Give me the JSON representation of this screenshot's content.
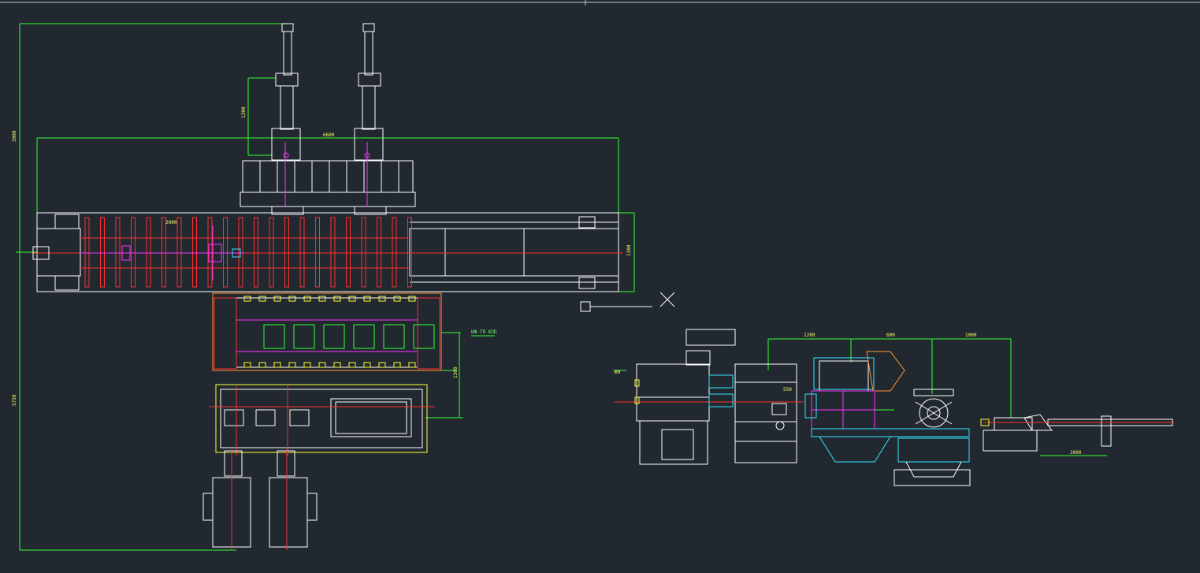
{
  "viewport": {
    "background": "#212830"
  },
  "colors": {
    "geometry": "#ffffff",
    "centerline": "#ff3030",
    "dimension": "#33ff33",
    "magenta": "#ff33ff",
    "cyan": "#33e6ff",
    "orange": "#ff9933",
    "yellow": "#ffff33",
    "dim_text": "#ffff66"
  },
  "icons": {
    "crosshair": "crosshair-cursor-icon",
    "pickbox": "pickbox-icon"
  },
  "drawings": [
    {
      "name": "plan-view-layout"
    },
    {
      "name": "elevation-view-layout"
    }
  ]
}
